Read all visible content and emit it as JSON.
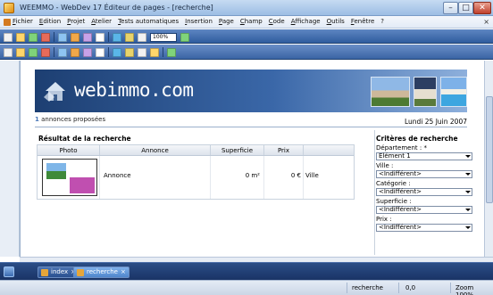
{
  "window": {
    "title": "WEEMMO - WebDev 17  Éditeur de pages - [recherche]",
    "minimize": "–",
    "maximize": "□",
    "close": "✕"
  },
  "menu": {
    "items": [
      "Fichier",
      "Edition",
      "Projet",
      "Atelier",
      "Tests automatiques",
      "Insertion",
      "Page",
      "Champ",
      "Code",
      "Affichage",
      "Outils",
      "Fenêtre",
      "?"
    ],
    "doc_close": "× "
  },
  "toolbar": {
    "zoom_value": "100%",
    "icons_row1": [
      "new-icon",
      "open-icon",
      "save-icon",
      "cut-icon",
      "copy-icon",
      "paste-icon",
      "undo-icon",
      "redo-icon",
      "run-icon",
      "debug-icon",
      "build-icon",
      "zoom-select",
      "help-icon"
    ],
    "icons_row2": [
      "align-left-icon",
      "align-center-icon",
      "align-right-icon",
      "same-width-icon",
      "same-height-icon",
      "group-icon",
      "layout-icon",
      "style-icon",
      "image-icon",
      "table-icon",
      "color-icon",
      "tabstop-icon",
      "anchor-icon"
    ]
  },
  "page": {
    "brand": "webimmo.com",
    "annonces_count": "1",
    "annonces_label": " annonces proposées",
    "date": "Lundi 25 Juin 2007",
    "results": {
      "title": "Résultat de la recherche",
      "columns": [
        "Photo",
        "Annonce",
        "Superficie",
        "Prix",
        ""
      ],
      "row": {
        "annonce": "Annonce",
        "superficie": "0 m²",
        "prix": "0 €",
        "ville": "Ville"
      }
    },
    "criteria": {
      "title": "Critères de recherche",
      "fields": [
        {
          "label": "Département : *",
          "value": "Elément 1"
        },
        {
          "label": "Ville :",
          "value": "<Indifférent>"
        },
        {
          "label": "Catégorie :",
          "value": "<Indifférent>"
        },
        {
          "label": "Superficie :",
          "value": "<Indifférent>"
        },
        {
          "label": "Prix :",
          "value": "<Indifférent>"
        }
      ]
    }
  },
  "taskbar": {
    "tabs": [
      "index",
      "recherche"
    ]
  },
  "status": {
    "context": "recherche",
    "coords": "0,0",
    "zoom": "Zoom 100%"
  },
  "colors": {
    "banner_dark": "#1d3f72",
    "banner_light": "#8eb0dc",
    "toolbar_blue": "#2f5c9e",
    "thumb_magenta": "#c04fb0"
  }
}
